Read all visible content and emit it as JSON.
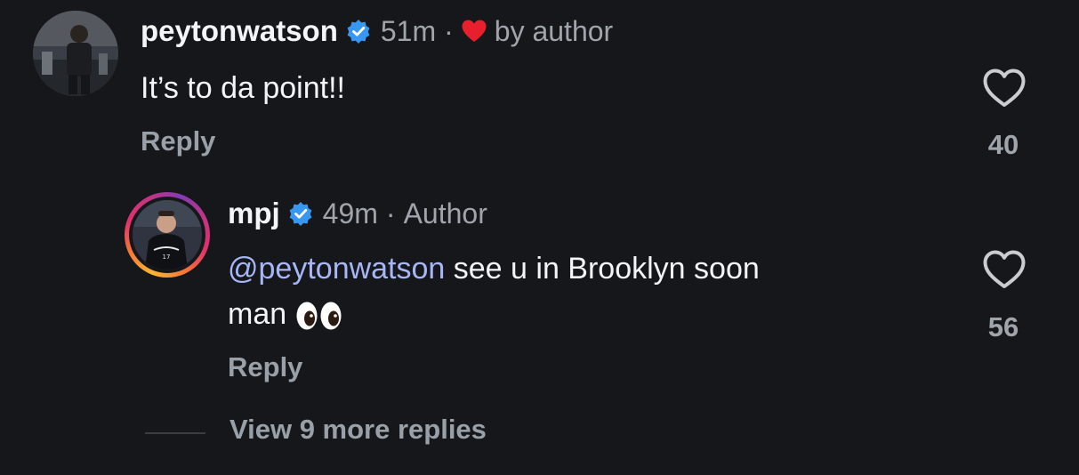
{
  "comment": {
    "username": "peytonwatson",
    "time": "51m",
    "separator": "·",
    "liked_by": "by author",
    "text": "It’s to da point!!",
    "reply_label": "Reply",
    "like_count": "40",
    "icons": {
      "verified": "verified-badge-icon",
      "liked": "heart-filled-icon",
      "like": "heart-outline-icon"
    },
    "colors": {
      "verified": "#3897f0",
      "liked_heart": "#e8202e"
    }
  },
  "reply": {
    "username": "mpj",
    "time": "49m",
    "separator": "·",
    "role": "Author",
    "mention": "@peytonwatson",
    "text": " see u in Brooklyn soon",
    "text_line2": "man",
    "reply_label": "Reply",
    "like_count": "56",
    "icons": {
      "verified": "verified-badge-icon",
      "emoji": "eyes-emoji-icon",
      "like": "heart-outline-icon"
    },
    "colors": {
      "mention": "#a7b6f6"
    }
  },
  "thread": {
    "view_more_label": "View 9 more replies"
  }
}
